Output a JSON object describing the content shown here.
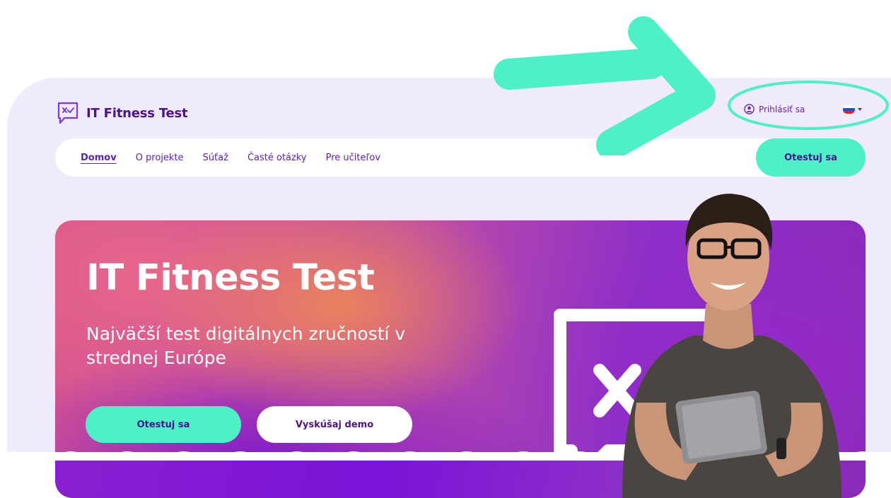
{
  "brand": {
    "name": "IT Fitness Test"
  },
  "header": {
    "login_label": "Prihlásiť sa",
    "language_flag": "slovak-flag"
  },
  "nav": {
    "items": [
      {
        "label": "Domov",
        "active": true
      },
      {
        "label": "O projekte"
      },
      {
        "label": "Súťaž"
      },
      {
        "label": "Časté otázky"
      },
      {
        "label": "Pre učiteľov"
      }
    ],
    "cta_label": "Otestuj sa"
  },
  "hero": {
    "title": "IT Fitness Test",
    "subtitle": "Najväčší test digitálnych zručností v strednej Európe",
    "primary_button": "Otestuj sa",
    "secondary_button": "Vyskúšaj demo"
  },
  "colors": {
    "brand_purple": "#4a148c",
    "accent_mint": "#4ef0c8",
    "page_bg": "#efeafc"
  }
}
